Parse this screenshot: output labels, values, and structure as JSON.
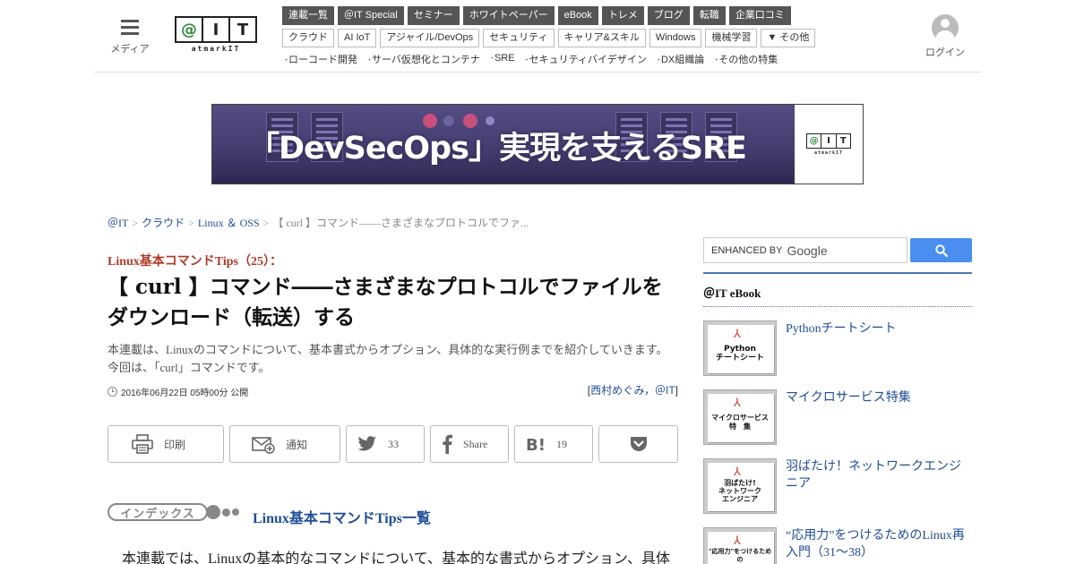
{
  "header": {
    "menu_label": "メディア",
    "logo": {
      "letters": [
        "@",
        "I",
        "T"
      ],
      "sub": "atmarkIT"
    },
    "nav_primary": [
      "連載一覧",
      "＠IT Special",
      "セミナー",
      "ホワイトペーパー",
      "eBook",
      "トレメ",
      "ブログ",
      "転職",
      "企業口コミ"
    ],
    "nav_secondary": [
      "クラウド",
      "AI IoT",
      "アジャイル/DevOps",
      "セキュリティ",
      "キャリア&スキル",
      "Windows",
      "機械学習",
      "▼ その他"
    ],
    "nav_features": [
      "ローコード開発",
      "サーバ仮想化とコンテナ",
      "SRE",
      "セキュリティバイデザイン",
      "DX組織論",
      "その他の特集"
    ],
    "login_label": "ログイン"
  },
  "banner": {
    "title": "「DevSecOps」実現を支えるSRE",
    "logo_letters": [
      "@",
      "I",
      "T"
    ],
    "logo_sub": "atmarkIT",
    "bg_color": "#4a447a"
  },
  "breadcrumb": {
    "items": [
      "＠IT",
      "クラウド",
      "Linux ＆ OSS"
    ],
    "current": "【 curl 】コマンド――さまざまなプロトコルでファ..."
  },
  "article": {
    "series": "Linux基本コマンドTips（25）：",
    "title": "【 curl 】コマンド――さまざまなプロトコルでファイルをダウンロード（転送）する",
    "lead_line1": "本連載は、Linuxのコマンドについて、基本書式からオプション、具体的な実行例までを紹介していきます。",
    "lead_line2": "今回は、「curl」コマンドです。",
    "date": "2016年06月22日 05時00分 公開",
    "author_prefix": "[",
    "author": "西村めぐみ，＠IT",
    "author_suffix": "]"
  },
  "share": {
    "print": "印刷",
    "notify": "通知",
    "twitter_count": "33",
    "facebook": "Share",
    "hatena_count": "19"
  },
  "index": {
    "badge": "インデックス",
    "link": "Linux基本コマンドTips一覧"
  },
  "body": {
    "first_line": "本連載では、Linuxの基本的なコマンドについて、基本的な書式からオプション、具体"
  },
  "sidebar": {
    "search_placeholder": "ENHANCED BY",
    "search_brand": "Google",
    "ebook_heading": "＠IT eBook",
    "ebooks": [
      {
        "title": "Pythonチートシート",
        "thumb": "Python\nチートシート"
      },
      {
        "title": "マイクロサービス特集",
        "thumb": "マイクロサービス\n特　集"
      },
      {
        "title": "羽ばたけ！ネットワークエンジニア",
        "thumb": "羽ばたけ!\nネットワーク\nエンジニア"
      },
      {
        "title": "“応用力”をつけるためのLinux再入門（31～38）",
        "thumb": "\"応用力\"をつけるための\nLinux再入門"
      }
    ]
  },
  "colors": {
    "nav_dark": "#555555",
    "link": "#1f4d99",
    "series_red": "#b23a2a",
    "search_button": "#4a8ef0",
    "sidebar_rule": "#4a78b4"
  }
}
